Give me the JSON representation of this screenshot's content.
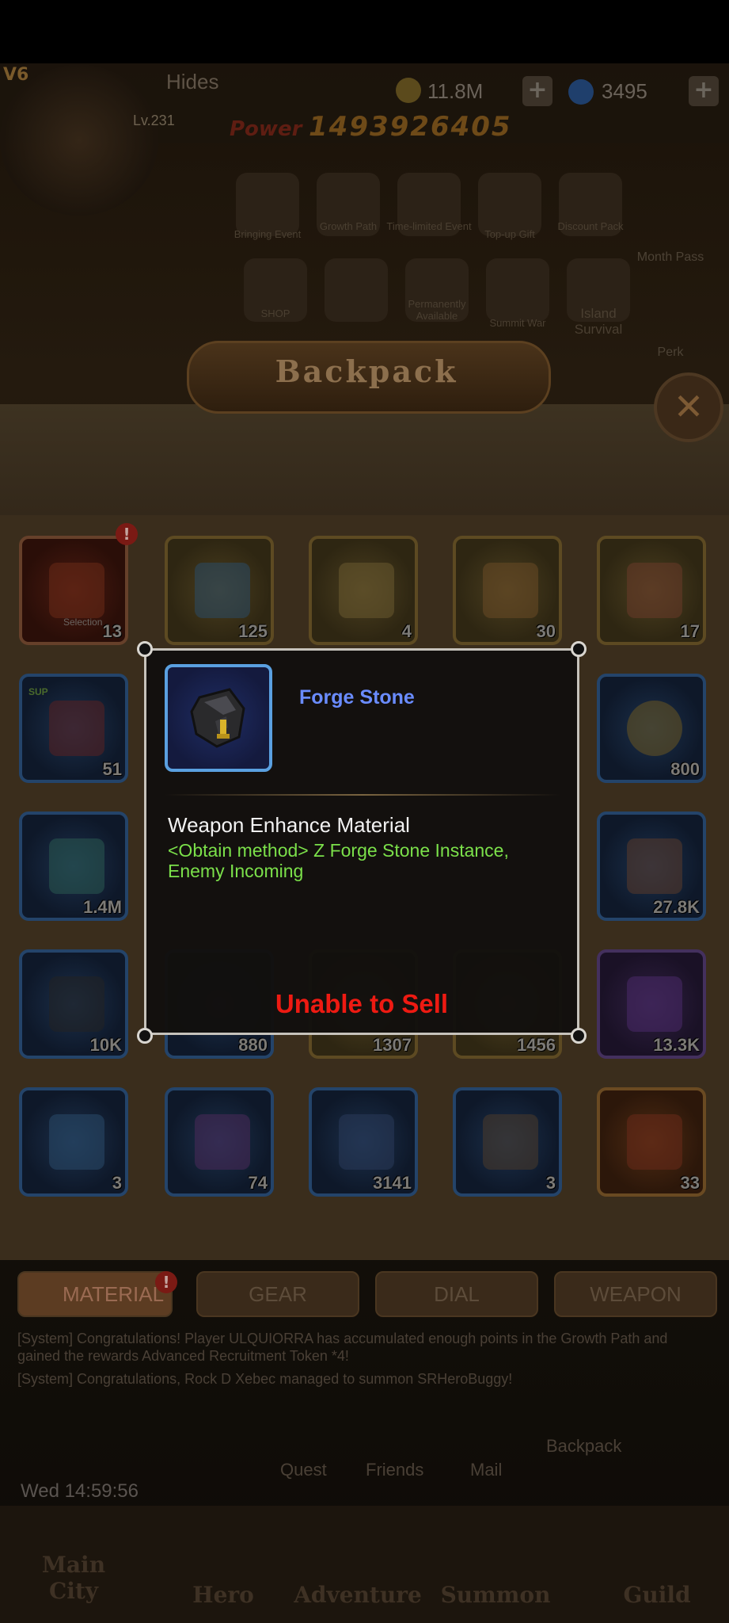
{
  "hud": {
    "vip": "V6",
    "player_name": "Hides",
    "level": "Lv.231",
    "power_label": "Power",
    "power": "1493926405",
    "gold": "11.8M",
    "gems": "3495",
    "plus": "+"
  },
  "events_row1": [
    "Bringing Event",
    "Growth Path",
    "Time-limited Event",
    "Top-up Gift",
    "Discount Pack"
  ],
  "events_row2": [
    "SHOP",
    "",
    "Permanently Available",
    "Summit War",
    "Island Survival"
  ],
  "side_menu": [
    "Month Pass",
    "Perk"
  ],
  "backpack": {
    "title": "Backpack",
    "close": "✕",
    "items": [
      {
        "count": "13",
        "label": "Selection",
        "badge": "!"
      },
      {
        "count": "125"
      },
      {
        "count": "4"
      },
      {
        "count": "30"
      },
      {
        "count": "17"
      },
      {
        "count": "51",
        "tag": "SUP"
      },
      {
        "count": "800"
      },
      {
        "count": "1.4M"
      },
      {
        "count": "27.8K"
      },
      {
        "count": "10K"
      },
      {
        "count": "880"
      },
      {
        "count": "1307"
      },
      {
        "count": "1456"
      },
      {
        "count": "13.3K"
      },
      {
        "count": "3"
      },
      {
        "count": "74"
      },
      {
        "count": "3141"
      },
      {
        "count": "3"
      },
      {
        "count": "33"
      }
    ]
  },
  "tabs": [
    {
      "label": "MATERIAL",
      "badge": "!"
    },
    {
      "label": "GEAR"
    },
    {
      "label": "DIAL"
    },
    {
      "label": "WEAPON"
    }
  ],
  "system_messages": [
    "[System] Congratulations! Player ULQUIORRA has accumulated enough points in the Growth Path and gained the rewards Advanced Recruitment Token *4!",
    "[System] Congratulations, Rock D Xebec managed to summon SRHeroBuggy!"
  ],
  "actions": [
    "Quest",
    "Friends",
    "Mail",
    "Backpack"
  ],
  "clock": "Wed 14:59:56",
  "nav": [
    "Main City",
    "Hero",
    "Adventure",
    "Summon",
    "Guild"
  ],
  "tooltip": {
    "name": "Forge Stone",
    "type": "Weapon Enhance Material",
    "obtain": "<Obtain method> Z Forge Stone Instance, Enemy Incoming",
    "sell": "Unable to Sell"
  },
  "colors": {
    "tooltip_name": "#6a8cff",
    "obtain": "#7be04a",
    "unsellable": "#ee1a12"
  }
}
